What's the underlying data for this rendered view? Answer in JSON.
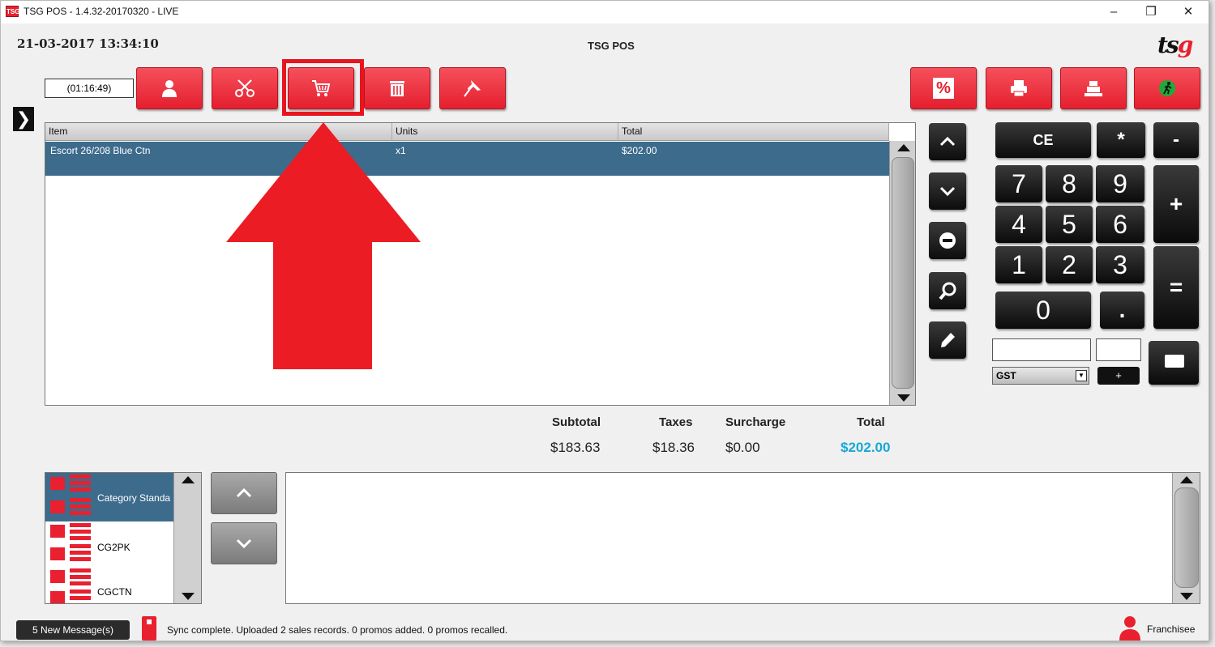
{
  "window": {
    "title": "TSG POS - 1.4.32-20170320 - LIVE",
    "app_icon_text": "TSG",
    "minimize": "–",
    "restore": "❐",
    "close": "✕"
  },
  "header": {
    "datetime": "21-03-2017 13:34:10",
    "center_title": "TSG POS",
    "logo_text_a": "ts",
    "logo_text_b": "g"
  },
  "toolbar": {
    "timer": "(01:16:49)",
    "left_buttons": [
      "user-icon",
      "scissors-icon",
      "cart-icon",
      "trash-icon",
      "pin-icon"
    ],
    "right_buttons": [
      "percent-icon",
      "printer-icon",
      "cash-register-icon",
      "exit-icon"
    ],
    "percent_label": "%",
    "highlighted": "cart-icon"
  },
  "sidebar_toggle": "❯",
  "grid": {
    "columns": [
      "Item",
      "Units",
      "Total"
    ],
    "rows": [
      {
        "item": "Escort 26/208 Blue Ctn",
        "units": "x1",
        "total": "$202.00"
      }
    ]
  },
  "totals": {
    "subtotal_label": "Subtotal",
    "taxes_label": "Taxes",
    "surcharge_label": "Surcharge",
    "total_label": "Total",
    "subtotal": "$183.63",
    "taxes": "$18.36",
    "surcharge": "$0.00",
    "total": "$202.00"
  },
  "keypad": {
    "ce": "CE",
    "star": "*",
    "minus": "-",
    "plus": "+",
    "equals": "=",
    "dot": ".",
    "digits": [
      "7",
      "8",
      "9",
      "4",
      "5",
      "6",
      "1",
      "2",
      "3",
      "0"
    ],
    "tax_select": "GST",
    "add_small": "+"
  },
  "categories": [
    {
      "label": "Category Standa"
    },
    {
      "label": "CG2PK"
    },
    {
      "label": "CGCTN"
    }
  ],
  "status": {
    "messages_button": "5 New Message(s)",
    "sync_text": "Sync complete.  Uploaded 2 sales records. 0 promos added. 0 promos recalled.",
    "user_role": "Franchisee"
  },
  "colors": {
    "accent_red": "#e8202f",
    "selection_blue": "#3d6b8c",
    "total_blue": "#17a8d8"
  }
}
